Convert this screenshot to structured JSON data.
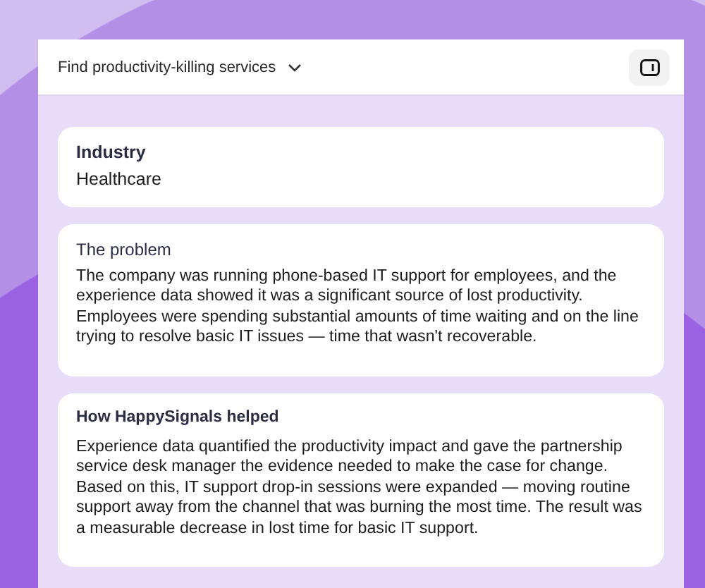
{
  "header": {
    "title": "Find productivity-killing services",
    "expanded": false
  },
  "cards": [
    {
      "kind": "field",
      "title": "Industry",
      "text": "Healthcare"
    },
    {
      "kind": "section",
      "title": "The problem",
      "text": "The company was running phone-based IT support for employees, and the experience data showed it was a significant source of lost productivity. Employees were spending substantial amounts of time waiting and on the line trying to resolve basic IT issues — time that wasn't recoverable."
    },
    {
      "kind": "section",
      "title": "How HappySignals helped",
      "text": "Experience data quantified the productivity impact and gave the partnership service desk manager the evidence needed to make the case for change. Based on this, IT support drop-in sessions were expanded — moving routine support away from the channel that was burning the most time. The result was a measurable decrease in lost time for basic IT support."
    }
  ]
}
